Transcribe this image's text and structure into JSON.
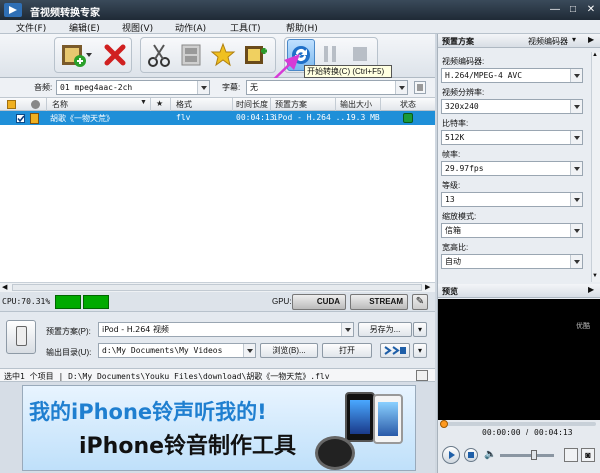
{
  "window": {
    "title": "音视频转换专家"
  },
  "menu": [
    "文件(F)",
    "编辑(E)",
    "视图(V)",
    "动作(A)",
    "工具(T)",
    "帮助(H)"
  ],
  "toolbar": {
    "icons": [
      "add-file-icon",
      "delete-icon",
      "cut-icon",
      "film-effects-icon",
      "star-icon",
      "add-more-icon",
      "convert-icon",
      "pause-icon",
      "stop-icon"
    ],
    "tooltip": "开始转换(C) (Ctrl+F5)"
  },
  "audio_row": {
    "audio_label": "音频:",
    "audio_value": "01 mpeg4aac-2ch",
    "subtitle_label": "字幕:",
    "subtitle_value": "无"
  },
  "file_list": {
    "headers": [
      "名称",
      "★",
      "格式",
      "时间长度",
      "预置方案",
      "输出大小",
      "状态"
    ],
    "rows": [
      {
        "name": "胡歌《一物天荒》",
        "format": "flv",
        "duration": "00:04:13",
        "preset": "iPod - H.264 ...",
        "size": "19.3 MB",
        "checked": true
      }
    ]
  },
  "gpu_bar": {
    "cpu": "CPU:70.31%",
    "gpu_label": "GPU:",
    "cuda": "CUDA",
    "stream": "STREAM"
  },
  "settings": {
    "preset_label": "预置方案(P):",
    "preset_value": "iPod - H.264 视频",
    "save_as": "另存为...",
    "output_label": "输出目录(U):",
    "output_value": "d:\\My Documents\\My Videos",
    "browse": "浏览(B)...",
    "open": "打开"
  },
  "status_bar": {
    "text": "选中1 个项目 | D:\\My Documents\\Youku Files\\download\\胡歌《一物天荒》.flv"
  },
  "ad": {
    "line1": "我的iPhone铃声听我的!",
    "line2": "iPhone铃音制作工具"
  },
  "right_panel": {
    "header": "预置方案",
    "header_dropdown": "视频编码器",
    "fields": [
      {
        "label": "视频编码器:",
        "value": "H.264/MPEG-4 AVC"
      },
      {
        "label": "视频分辨率:",
        "value": "320x240"
      },
      {
        "label": "比特率:",
        "value": "512K"
      },
      {
        "label": "帧率:",
        "value": "29.97fps"
      },
      {
        "label": "等级:",
        "value": "13"
      },
      {
        "label": "缩放模式:",
        "value": "信箱"
      },
      {
        "label": "宽高比:",
        "value": "自动"
      }
    ],
    "preview_header": "预览",
    "preview_watermark": "优酷",
    "time_current": "00:00:00",
    "time_total": "00:04:13",
    "volume": 0.65
  },
  "colors": {
    "selection": "#1f8fd8",
    "titlebar": "#1f2a36",
    "accent_arrow": "#d63bd6"
  }
}
